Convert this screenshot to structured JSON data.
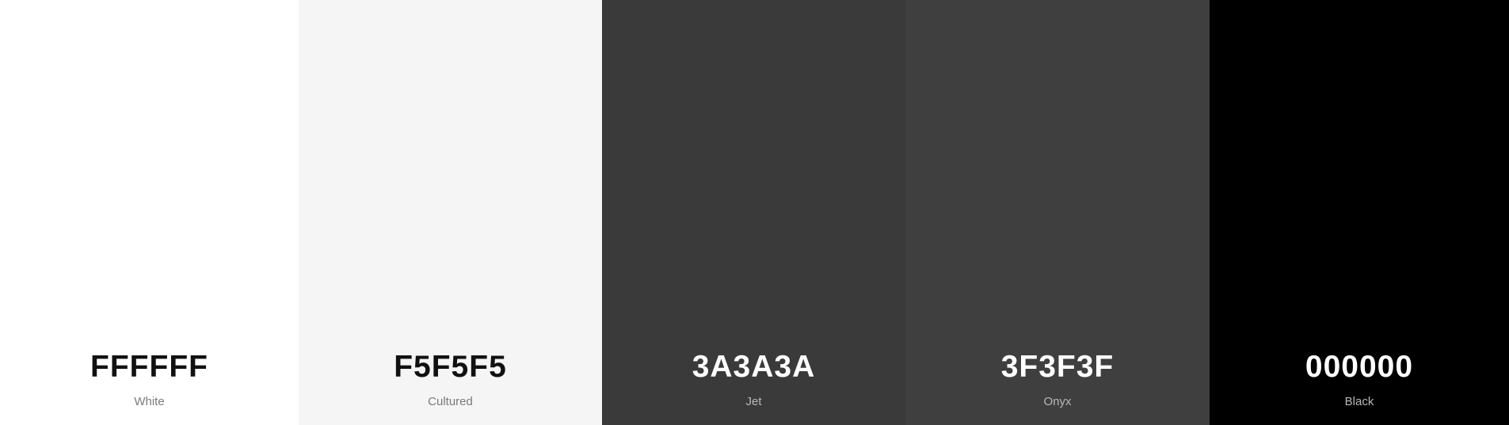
{
  "swatches": [
    {
      "hex": "FFFFFF",
      "name": "White",
      "color": "#FFFFFF",
      "tone": "light"
    },
    {
      "hex": "F5F5F5",
      "name": "Cultured",
      "color": "#F5F5F5",
      "tone": "light"
    },
    {
      "hex": "3A3A3A",
      "name": "Jet",
      "color": "#3A3A3A",
      "tone": "dark"
    },
    {
      "hex": "3F3F3F",
      "name": "Onyx",
      "color": "#3F3F3F",
      "tone": "dark"
    },
    {
      "hex": "000000",
      "name": "Black",
      "color": "#000000",
      "tone": "dark"
    }
  ]
}
